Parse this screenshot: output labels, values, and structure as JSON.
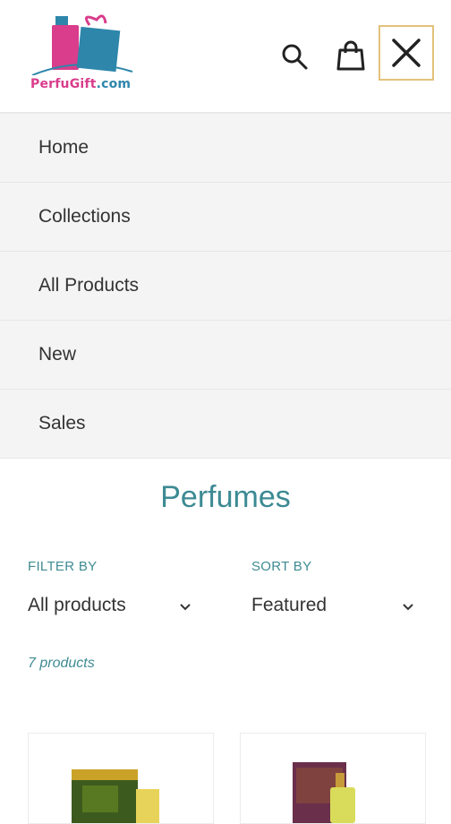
{
  "brand": {
    "name_part1": "PerfuGift",
    "name_part2": ".com",
    "colors": {
      "pink": "#d93d8c",
      "blue": "#2e86ab",
      "accent_border": "#e2c27a",
      "teal_text": "#3c8a93"
    }
  },
  "header": {
    "icons": [
      "search-icon",
      "shopping-bag-icon",
      "close-icon"
    ]
  },
  "nav": {
    "items": [
      {
        "label": "Home"
      },
      {
        "label": "Collections"
      },
      {
        "label": "All Products"
      },
      {
        "label": "New"
      },
      {
        "label": "Sales"
      }
    ]
  },
  "collection": {
    "title": "Perfumes",
    "filter": {
      "label": "FILTER BY",
      "value": "All products"
    },
    "sort": {
      "label": "SORT BY",
      "value": "Featured"
    },
    "count": "7 products"
  }
}
